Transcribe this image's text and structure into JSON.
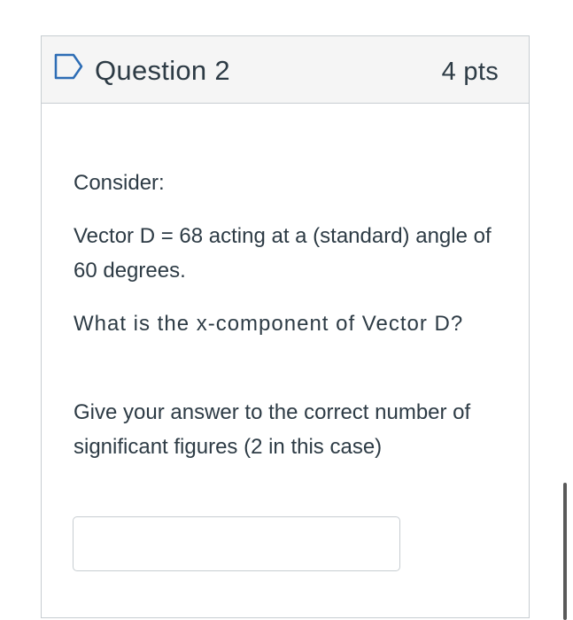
{
  "question": {
    "title": "Question 2",
    "points": "4 pts",
    "flag_icon": "bookmark-flag-icon",
    "body": {
      "consider": "Consider:",
      "vector_statement": "Vector D = 68 acting at a (standard) angle of 60 degrees.",
      "prompt": "What is the x-component of Vector D?",
      "instructions": "Give your answer to the correct number of significant figures (2 in this case)"
    },
    "answer": {
      "value": "",
      "placeholder": ""
    }
  },
  "colors": {
    "text": "#2d3b45",
    "flag": "#2d6db5",
    "border": "#c7cdd1",
    "header_bg": "#f5f5f5"
  }
}
